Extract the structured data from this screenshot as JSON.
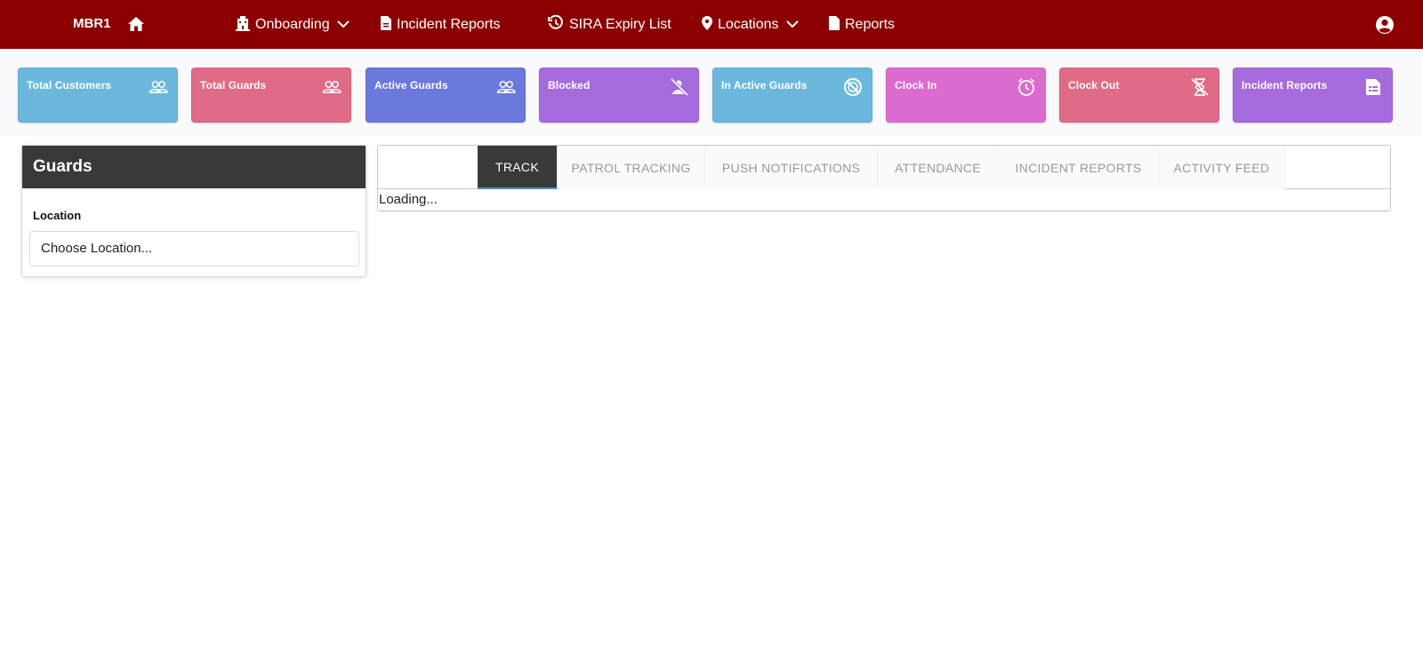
{
  "navbar": {
    "brand": "MBR1",
    "items": [
      {
        "label": "Onboarding",
        "icon": "building-icon",
        "dropdown": true
      },
      {
        "label": "Incident Reports",
        "icon": "document-icon",
        "dropdown": false
      },
      {
        "label": "SIRA Expiry List",
        "icon": "history-icon",
        "dropdown": false
      },
      {
        "label": "Locations",
        "icon": "map-pin-icon",
        "dropdown": true
      },
      {
        "label": "Reports",
        "icon": "file-icon",
        "dropdown": false
      }
    ],
    "bg_color": "#8b0000"
  },
  "cards": [
    {
      "label": "Total Customers",
      "icon": "users-icon",
      "color": "#6bb8dc"
    },
    {
      "label": "Total Guards",
      "icon": "users-icon",
      "color": "#df6b87"
    },
    {
      "label": "Active Guards",
      "icon": "users-icon",
      "color": "#6b78dc"
    },
    {
      "label": "Blocked",
      "icon": "user-blocked-icon",
      "color": "#a56bdc"
    },
    {
      "label": "In Active Guards",
      "icon": "ban-icon",
      "color": "#6bb8dc"
    },
    {
      "label": "Clock In",
      "icon": "alarm-clock-icon",
      "color": "#dc6bcf"
    },
    {
      "label": "Clock Out",
      "icon": "hourglass-icon",
      "color": "#df6b87"
    },
    {
      "label": "Incident Reports",
      "icon": "report-icon",
      "color": "#a56bdc"
    }
  ],
  "guards_panel": {
    "title": "Guards",
    "location_label": "Location",
    "location_value": "Choose Location..."
  },
  "tabs": {
    "items": [
      "TRACK",
      "PATROL TRACKING",
      "PUSH NOTIFICATIONS",
      "ATTENDANCE",
      "INCIDENT REPORTS",
      "ACTIVITY FEED"
    ],
    "active": "TRACK"
  },
  "content": {
    "loading_text": "Loading..."
  }
}
